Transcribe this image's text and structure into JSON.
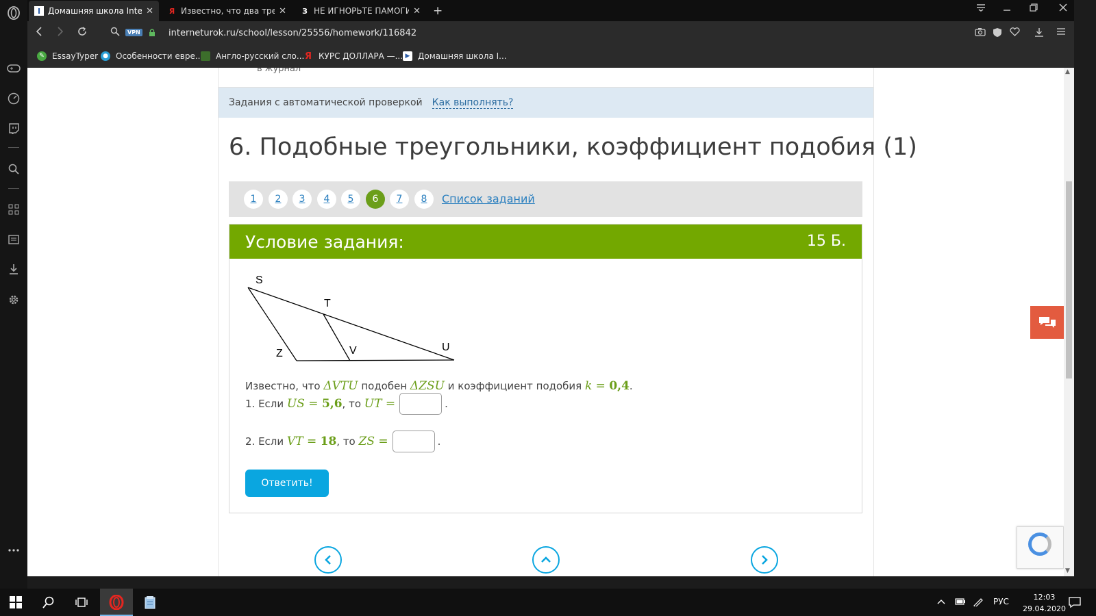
{
  "browser": {
    "tabs": [
      {
        "title": "Домашняя школа Internet",
        "favicon": "I",
        "active": true
      },
      {
        "title": "Известно, что два треугол",
        "favicon": "Я",
        "active": false
      },
      {
        "title": "НЕ ИГНОРЬТЕ ПАМОГИТЕ",
        "favicon": "З",
        "active": false
      }
    ],
    "new_tab": "+",
    "vpn_badge": "VPN",
    "url": "interneturok.ru/school/lesson/25556/homework/116842",
    "bookmarks": [
      {
        "label": "EssayTyper",
        "icon_color": "#49a942"
      },
      {
        "label": "Особенности евре...",
        "icon_color": "#2a9fd6"
      },
      {
        "label": "Англо-русский сло...",
        "icon_color": "#3c6e2b"
      },
      {
        "label": "КУРС ДОЛЛАРА —...",
        "icon_color": "#e52620"
      },
      {
        "label": "Домашняя школа I...",
        "icon_color": "#2d5ea8"
      }
    ]
  },
  "page": {
    "journal_text": "в журнал",
    "auto_check": "Задания с автоматической проверкой",
    "how_to": "Как выполнять?",
    "title": "6. Подобные треугольники, коэффициент подобия (1)",
    "pager": {
      "pages": [
        "1",
        "2",
        "3",
        "4",
        "5",
        "6",
        "7",
        "8"
      ],
      "current": "6",
      "task_list": "Список заданий"
    },
    "task": {
      "heading": "Условие задания:",
      "points": "15 Б.",
      "figure_labels": {
        "S": "S",
        "T": "T",
        "Z": "Z",
        "V": "V",
        "U": "U"
      },
      "statement": {
        "prefix": "Известно, что ",
        "tri1": "ΔVTU",
        "mid": " подобен ",
        "tri2": "ΔZSU",
        "mid2": " и коэффициент подобия ",
        "k_var": "k",
        "k_eq": " = ",
        "k_val": "0,4",
        "end": "."
      },
      "q1": {
        "prefix": "1. Если ",
        "var": "US",
        "eq": " = ",
        "val": "5,6",
        "mid": ", то ",
        "target": "UT",
        "target_eq": " =",
        "end": "."
      },
      "q2": {
        "prefix": "2. Если ",
        "var": "VT",
        "eq": " = ",
        "val": "18",
        "mid": ", то ",
        "target": "ZS",
        "target_eq": " =",
        "end": "."
      },
      "submit": "Ответить!"
    }
  },
  "taskbar": {
    "lang": "РУС",
    "time": "12:03",
    "date": "29.04.2020"
  },
  "colors": {
    "accent_green": "#73a800",
    "link_blue": "#2a7fbf",
    "button_blue": "#0aa6e0",
    "chat_red": "#e35b3f"
  }
}
